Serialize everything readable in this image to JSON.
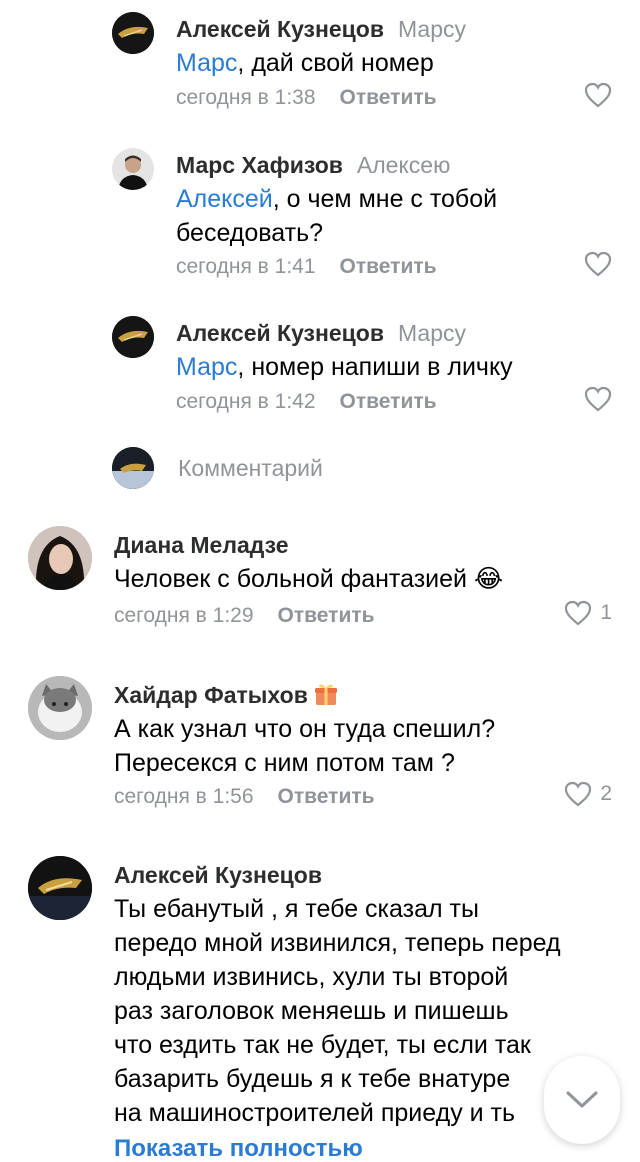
{
  "replies": [
    {
      "author": "Алексей Кузнецов",
      "reply_to": "Марсу",
      "mention": "Марс",
      "text": ", дай свой номер",
      "time": "сегодня в 1:38",
      "reply_label": "Ответить"
    },
    {
      "author": "Марс Хафизов",
      "reply_to": "Алексею",
      "mention": "Алексей",
      "text_line1": ", о чем мне с тобой",
      "text_line2": "беседовать?",
      "time": "сегодня в 1:41",
      "reply_label": "Ответить"
    },
    {
      "author": "Алексей Кузнецов",
      "reply_to": "Марсу",
      "mention": "Марс",
      "text": ", номер напиши в личку",
      "time": "сегодня в 1:42",
      "reply_label": "Ответить"
    }
  ],
  "comment_input": {
    "placeholder": "Комментарий"
  },
  "comments": [
    {
      "author": "Диана Меладзе",
      "text": "Человек с больной фантазией 😂",
      "time": "сегодня в 1:29",
      "reply_label": "Ответить",
      "likes": "1"
    },
    {
      "author": "Хайдар Фатыхов",
      "text_line1": "А как узнал что он туда спешил?",
      "text_line2": "Пересекся с ним потом там ?",
      "time": "сегодня в 1:56",
      "reply_label": "Ответить",
      "likes": "2"
    },
    {
      "author": "Алексей Кузнецов",
      "text_lines": [
        "Ты ебанутый , я тебе сказал ты",
        "передо мной извинился, теперь перед",
        "людьми извинись, хули ты второй",
        "раз заголовок меняешь и пишешь",
        "что ездить так не будет, ты если так",
        "базарить будешь я к тебе внатуре",
        "на машиностроителей приеду и ть"
      ],
      "show_more": "Показать полностью"
    }
  ],
  "colors": {
    "accent": "#2a7bd4",
    "secondary": "#909499"
  },
  "icons": {
    "like": "heart-outline-icon",
    "scroll": "chevron-down-icon",
    "gift": "gift-icon"
  }
}
